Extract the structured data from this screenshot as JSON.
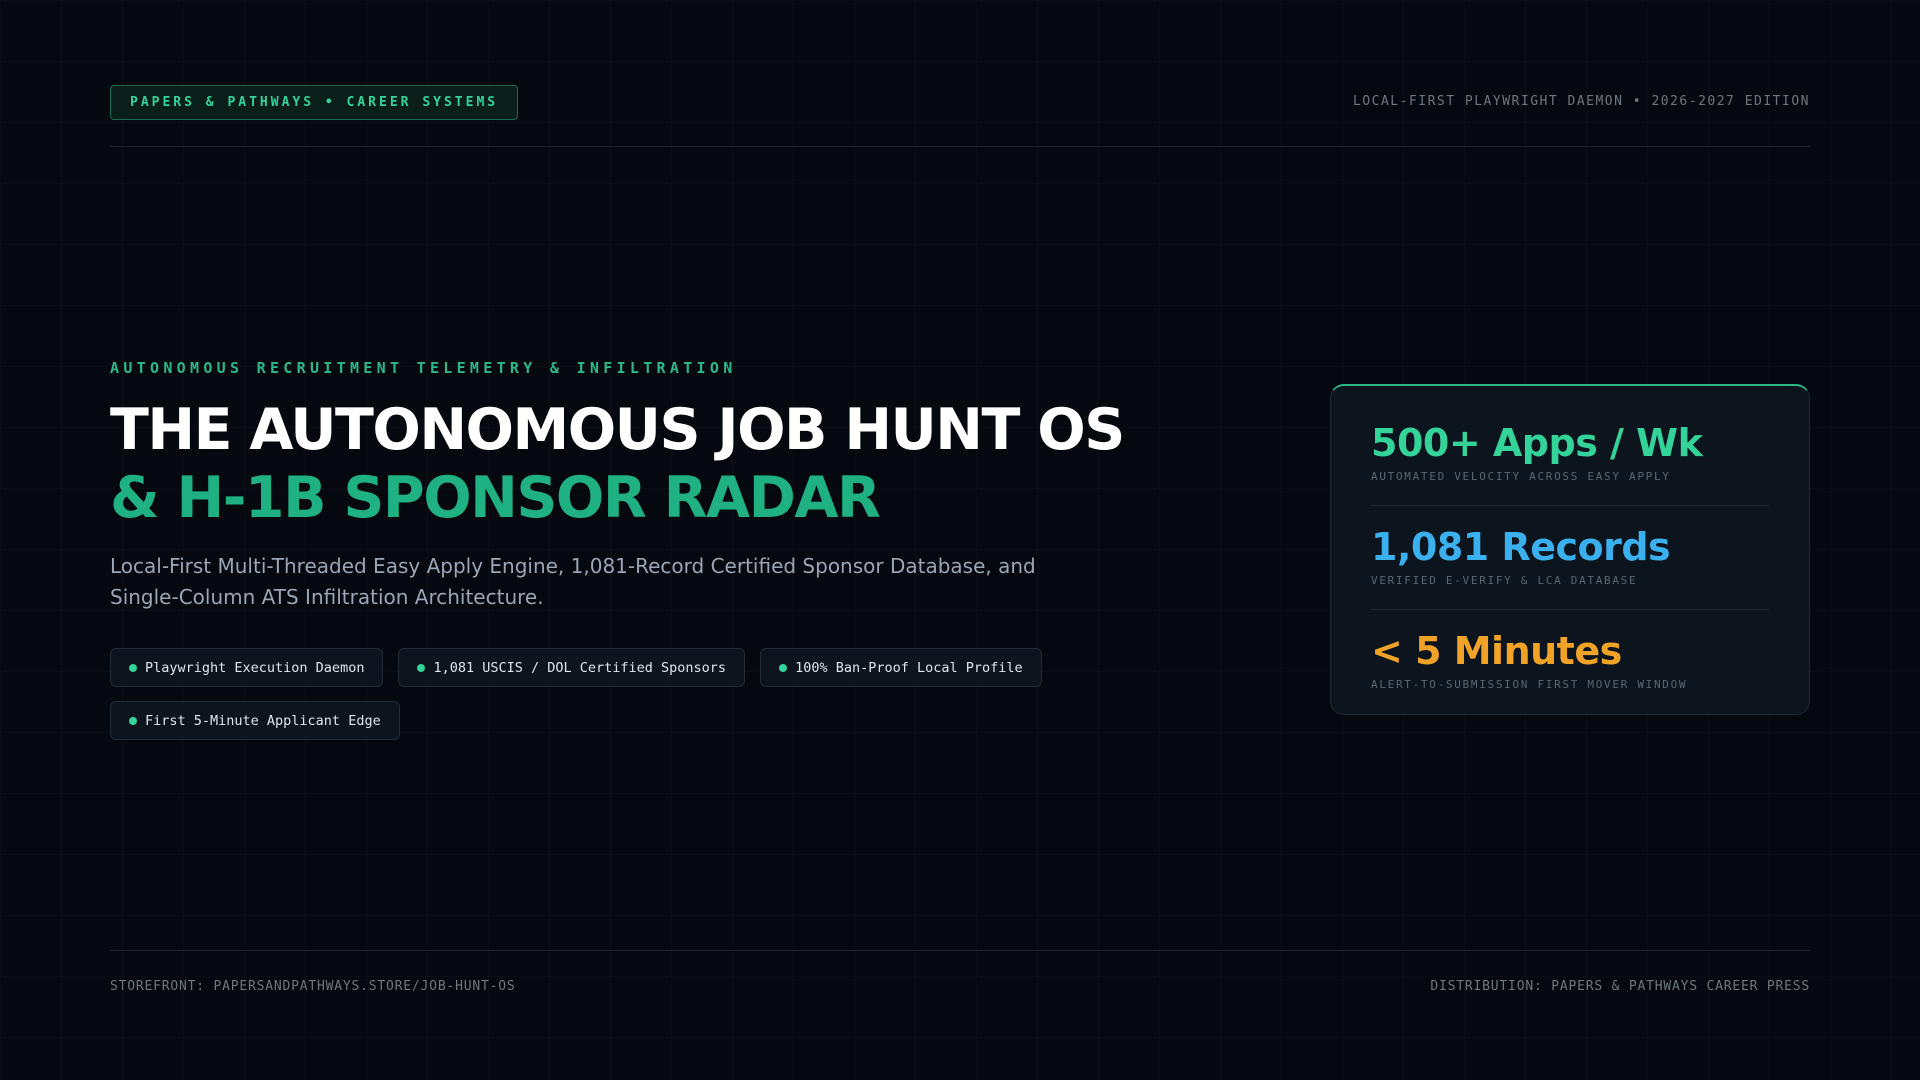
{
  "header": {
    "badge": "PAPERS & PATHWAYS • CAREER SYSTEMS",
    "edition": "LOCAL-FIRST PLAYWRIGHT DAEMON • 2026-2027 EDITION"
  },
  "hero": {
    "eyebrow": "AUTONOMOUS RECRUITMENT TELEMETRY & INFILTRATION",
    "title_line_1": "THE AUTONOMOUS JOB HUNT OS",
    "title_line_2": "& H-1B SPONSOR RADAR",
    "subtitle": "Local-First Multi-Threaded Easy Apply Engine, 1,081-Record Certified Sponsor Database, and Single-Column ATS Infiltration Architecture."
  },
  "chips": [
    "Playwright Execution Daemon",
    "1,081 USCIS / DOL Certified Sponsors",
    "100% Ban-Proof Local Profile",
    "First 5-Minute Applicant Edge"
  ],
  "stats": [
    {
      "value": "500+ Apps / Wk",
      "caption": "AUTOMATED VELOCITY ACROSS EASY APPLY",
      "color": "#34d399"
    },
    {
      "value": "1,081 Records",
      "caption": "VERIFIED E-VERIFY & LCA DATABASE",
      "color": "#3bb0ee"
    },
    {
      "value": "< 5 Minutes",
      "caption": "ALERT-TO-SUBMISSION FIRST MOVER WINDOW",
      "color": "#f0a327"
    }
  ],
  "footer": {
    "storefront": "STOREFRONT: PAPERSANDPATHWAYS.STORE/JOB-HUNT-OS",
    "distribution": "DISTRIBUTION: PAPERS & PATHWAYS CAREER PRESS"
  },
  "colors": {
    "background": "#05090f",
    "accent_green": "#34d399",
    "title_green": "#1fb182",
    "accent_blue": "#3bb0ee",
    "accent_amber": "#f0a327"
  }
}
